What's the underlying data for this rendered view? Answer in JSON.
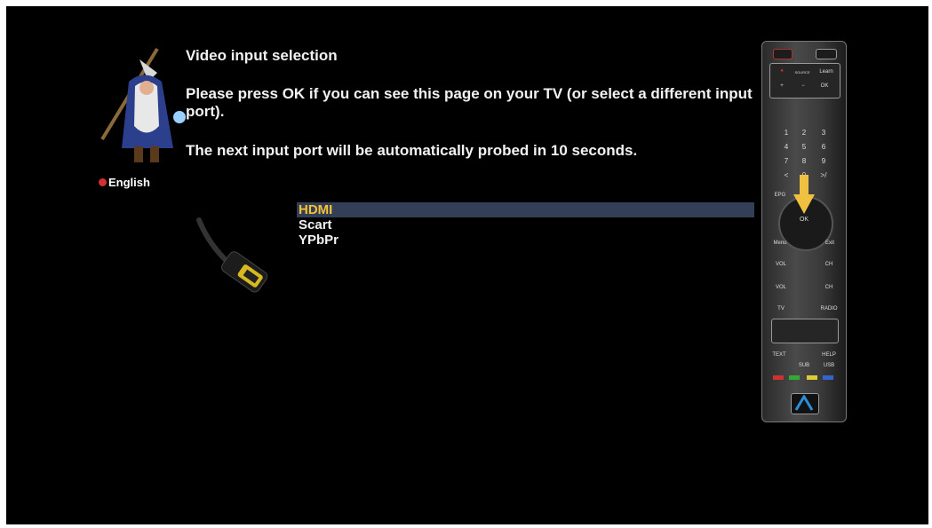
{
  "language": "English",
  "title": "Video input selection",
  "message_1": "Please press OK if you can see this page on your TV (or select a different input port).",
  "message_2": "The next input port will be automatically probed in 10 seconds.",
  "inputs": [
    {
      "label": "HDMI",
      "selected": true
    },
    {
      "label": "Scart",
      "selected": false
    },
    {
      "label": "YPbPr",
      "selected": false
    }
  ],
  "remote": {
    "ok_label": "OK",
    "learn_label": "Learn",
    "menu_label": "Menu",
    "exit_label": "Exit",
    "epg_label": "EPG",
    "vol_label": "VOL",
    "ch_label": "CH",
    "tv_label": "TV",
    "radio_label": "RADIO",
    "text_label": "TEXT",
    "sub_label": "SUB",
    "usb_label": "USB",
    "help_label": "HELP",
    "source_label": "SOURCE",
    "numbers": [
      "1",
      "2",
      "3",
      "4",
      "5",
      "6",
      "7",
      "8",
      "9",
      "<",
      "0",
      ">/"
    ]
  },
  "colors": {
    "background": "#000000",
    "selection_bg": "#333e57",
    "selection_text": "#f4c234",
    "text": "#f2f2f2",
    "arrow": "#f0c040",
    "logo": "#2a8fd8"
  }
}
